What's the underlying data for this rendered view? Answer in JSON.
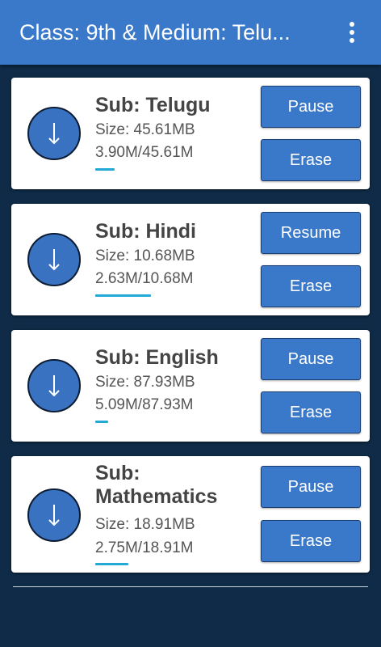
{
  "header": {
    "title": "Class: 9th & Medium: Telu...",
    "menu_icon": "more-vert-icon"
  },
  "colors": {
    "appbar": "#3a78c9",
    "background": "#0f2b47",
    "button": "#3a78c9",
    "progress": "#22a9d6"
  },
  "downloads": [
    {
      "subject": "Sub: Telugu",
      "size": "Size: 45.61MB",
      "progress": "3.90M/45.61M",
      "progress_fraction": 0.086,
      "primary_label": "Pause",
      "erase_label": "Erase",
      "icon": "download-arrow-icon"
    },
    {
      "subject": "Sub: Hindi",
      "size": "Size: 10.68MB",
      "progress": "2.63M/10.68M",
      "progress_fraction": 0.246,
      "primary_label": "Resume",
      "erase_label": "Erase",
      "icon": "download-arrow-icon"
    },
    {
      "subject": "Sub: English",
      "size": "Size: 87.93MB",
      "progress": "5.09M/87.93M",
      "progress_fraction": 0.058,
      "primary_label": "Pause",
      "erase_label": "Erase",
      "icon": "download-arrow-icon"
    },
    {
      "subject": "Sub: Mathematics",
      "size": "Size: 18.91MB",
      "progress": "2.75M/18.91M",
      "progress_fraction": 0.145,
      "primary_label": "Pause",
      "erase_label": "Erase",
      "icon": "download-arrow-icon"
    }
  ]
}
